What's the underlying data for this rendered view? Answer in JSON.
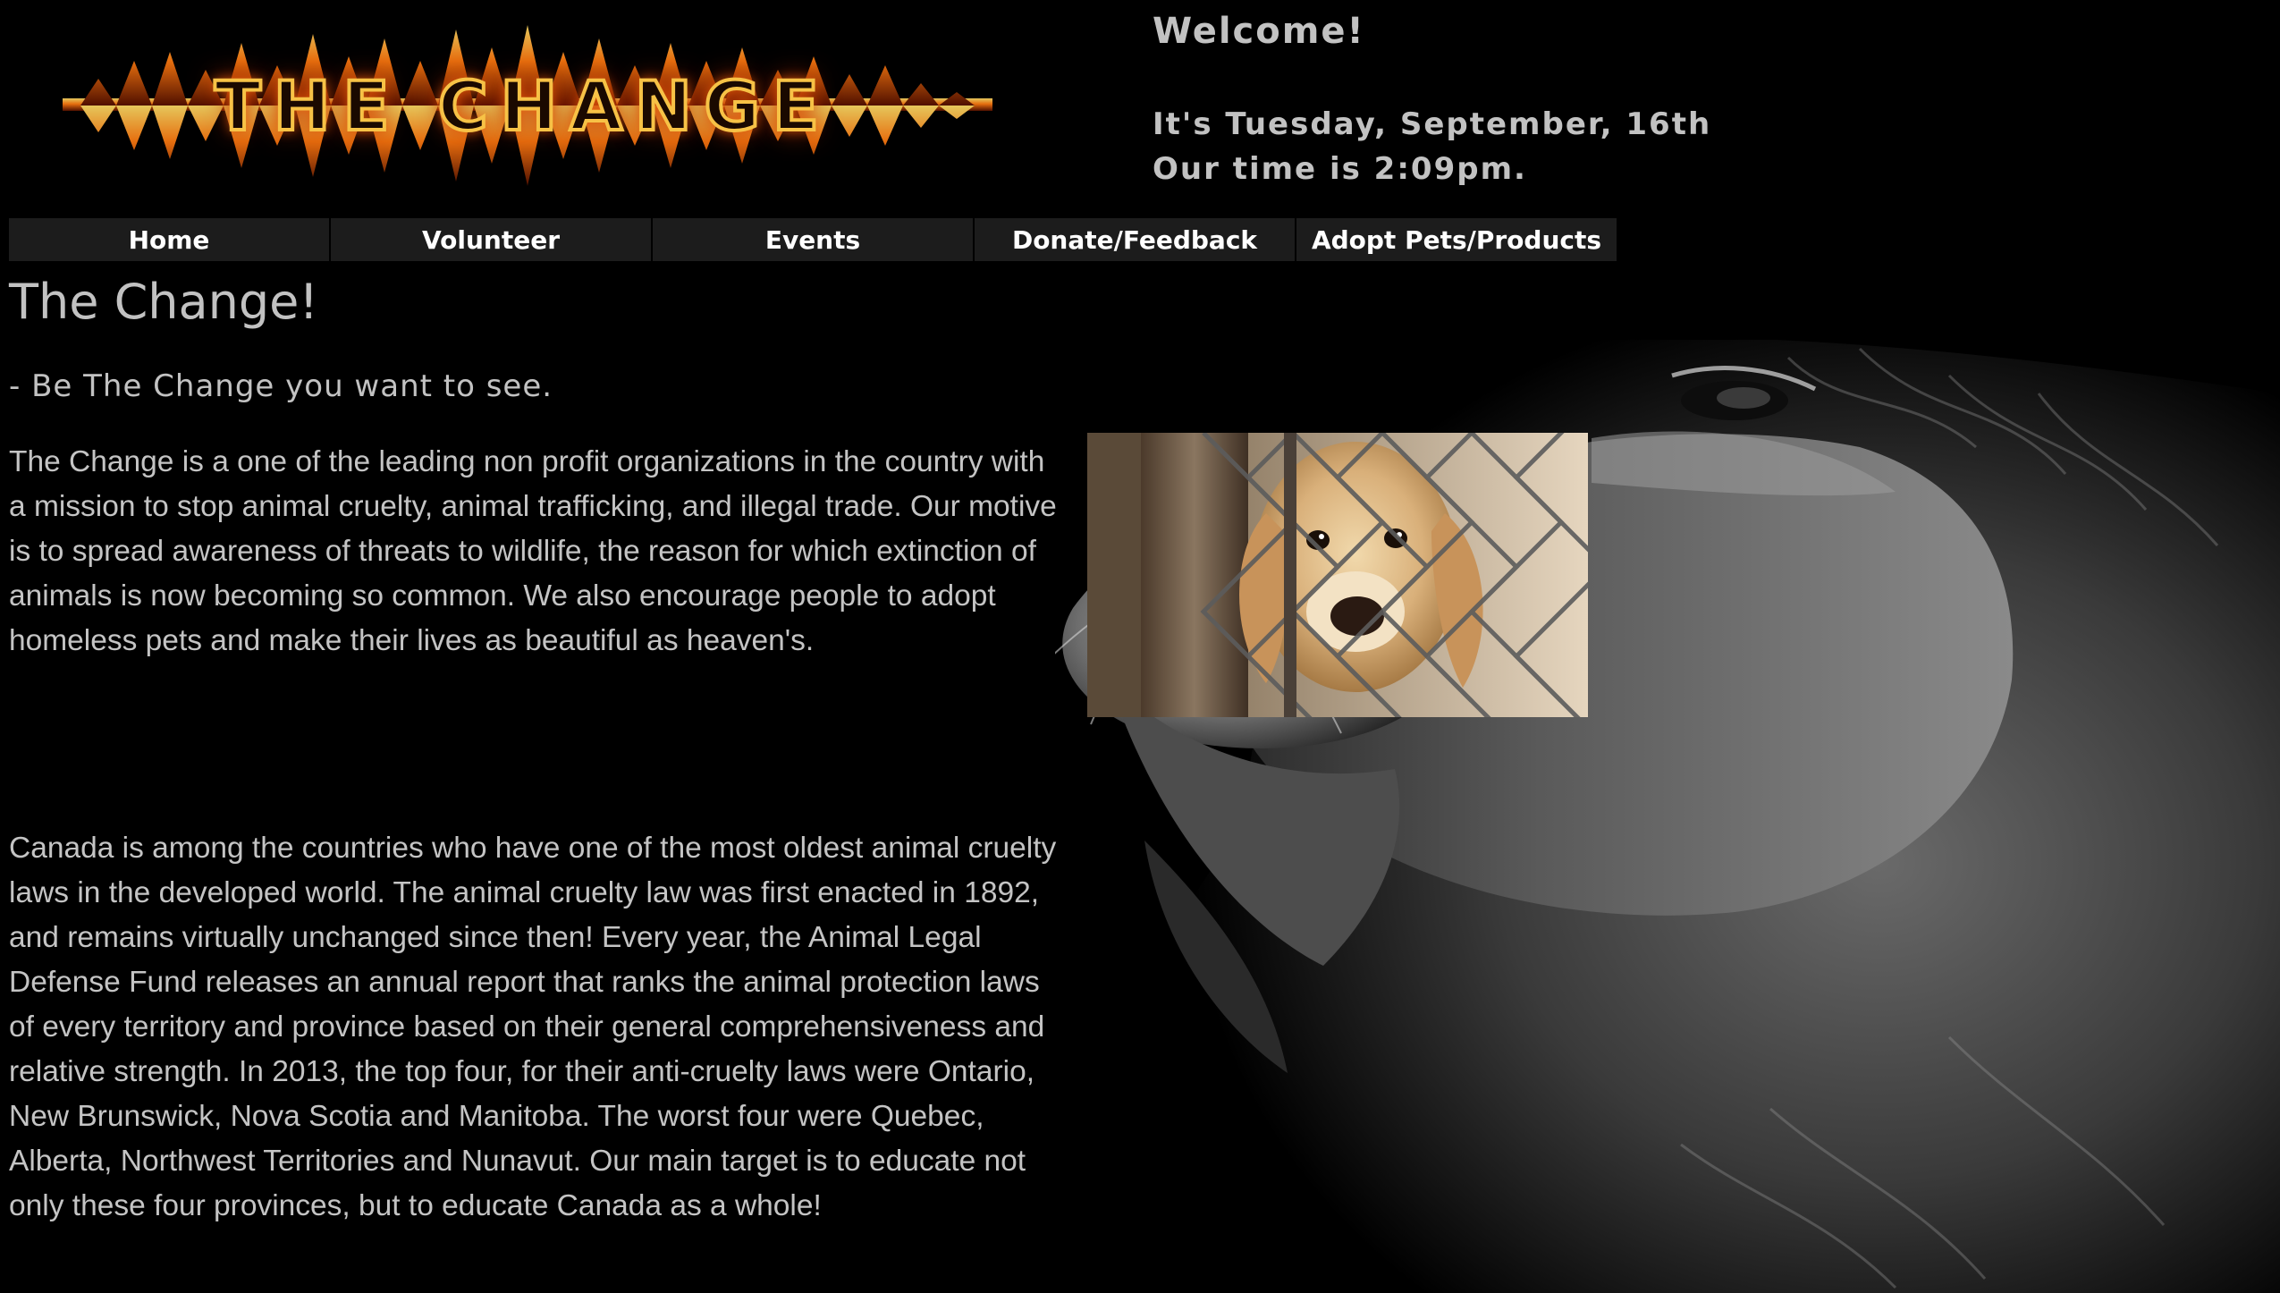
{
  "logo": {
    "text": "THE CHANGE",
    "accent": "#f7c246",
    "glow": "#e85b0b"
  },
  "welcome": {
    "title": "Welcome!",
    "date_line": "It's Tuesday, September, 16th",
    "time_line": "Our time is 2:09pm."
  },
  "nav": {
    "items": [
      {
        "label": "Home"
      },
      {
        "label": "Volunteer"
      },
      {
        "label": "Events"
      },
      {
        "label": "Donate/Feedback"
      },
      {
        "label": "Adopt Pets/Products"
      }
    ]
  },
  "main": {
    "title": "The Change!",
    "tagline": "- Be The Change you want to see.",
    "paragraph1": "The Change is a one of the leading non profit organizations in the country with a mission to stop animal cruelty, animal trafficking, and illegal trade. Our motive is to spread awareness of threats to wildlife, the reason for which extinction of animals is now becoming so common. We also encourage people to adopt homeless pets and make their lives as beautiful as heaven's.",
    "paragraph2": "Canada is among the countries who have one of the most oldest animal cruelty laws in the developed world. The animal cruelty law was first enacted in 1892, and remains virtually unchanged since then! Every year, the Animal Legal Defense Fund releases an annual report that ranks the animal protection laws of every territory and province based on their general comprehensiveness and relative strength. In 2013, the top four, for their anti-cruelty laws were Ontario, New Brunswick, Nova Scotia and Manitoba. The worst four were Quebec, Alberta, Northwest Territories and Nunavut. Our main target is to educate not only these four provinces, but to educate Canada as a whole!"
  },
  "colors": {
    "background": "#000000",
    "text": "#c4c4c4",
    "nav_bg": "#1c1c1c",
    "nav_text": "#ffffff"
  }
}
